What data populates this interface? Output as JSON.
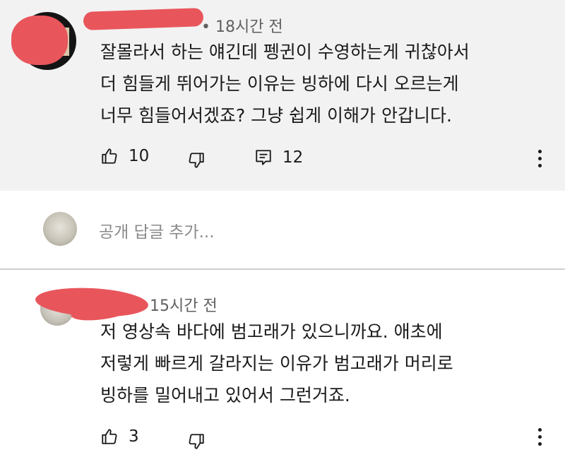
{
  "comment1": {
    "time": "• 18시간 전",
    "lines": [
      "잘몰라서 하는 얘긴데 펭귄이 수영하는게 귀찮아서",
      "더 힘들게 뛰어가는 이유는 빙하에 다시 오르는게",
      "너무 힘들어서겠죠? 그냥 쉽게 이해가 안갑니다."
    ],
    "likes": "10",
    "replies": "12",
    "icons": [
      "thumb-up-icon",
      "thumb-down-icon",
      "reply-icon",
      "more-vert-icon"
    ]
  },
  "reply_input": {
    "placeholder": "공개 답글 추가..."
  },
  "comment2": {
    "time": "15시간 전",
    "lines": [
      "저 영상속 바다에 범고래가 있으니까요. 애초에",
      "저렇게 빠르게 갈라지는 이유가 범고래가 머리로",
      "빙하를 밀어내고 있어서 그런거죠."
    ],
    "likes": "3",
    "icons": [
      "thumb-up-icon",
      "thumb-down-icon",
      "more-vert-icon"
    ]
  },
  "colors": {
    "highlight_bg": "#f2f2f2",
    "redaction": "#e8565c",
    "meta_text": "#606060",
    "divider": "#cfcfcf"
  }
}
